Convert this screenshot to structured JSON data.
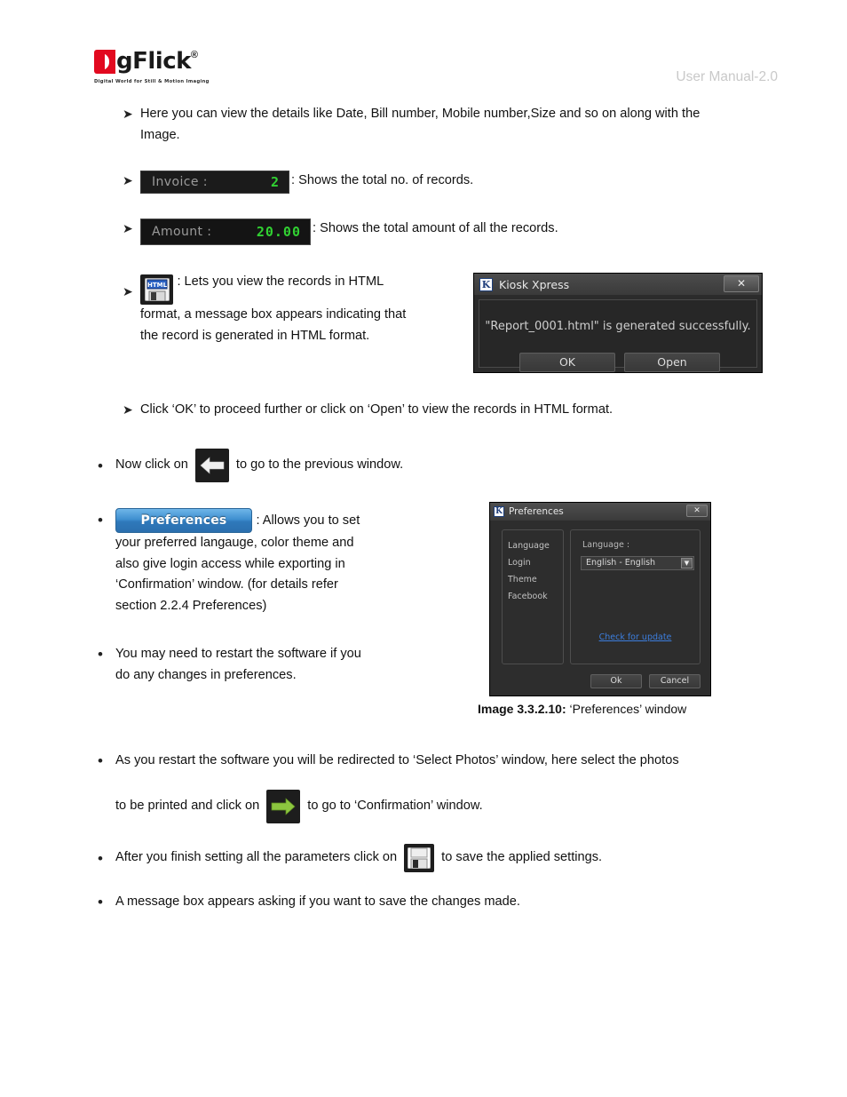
{
  "header": {
    "logo_d": "D",
    "logo_rest": "gFlick",
    "logo_registered": "®",
    "logo_tagline": "Digital World for Still & Motion Imaging",
    "manual_label": "User Manual-2.0"
  },
  "body": {
    "item1": "Here you can view the details like Date, Bill number, Mobile number,Size and so on along with the Image.",
    "invoice": {
      "label": "Invoice :",
      "value": "2",
      "description": ": Shows the total no. of records."
    },
    "amount": {
      "label": "Amount :",
      "value": "20.00",
      "description": ": Shows the total amount of all the records."
    },
    "html_item": {
      "icon_label": "HTML",
      "text": ": Lets you view the records in HTML format, a message box appears indicating that the record is generated in HTML format."
    },
    "item_ok_open": "Click ‘OK’ to proceed further or click on ‘Open’ to view the records in HTML format.",
    "back_item": {
      "prefix": "Now click on",
      "suffix": "to go to the previous window."
    },
    "preferences_item": {
      "button_label": "Preferences",
      "text_after_button": ": Allows you to set",
      "line2": "your preferred langauge, color theme and",
      "line3": "also give login access while exporting in",
      "line4": "‘Confirmation’ window. (for details refer",
      "line5": "section 2.2.4 Preferences)"
    },
    "restart_item": {
      "line1": "You may need to restart the software if you",
      "line2": "do any changes in preferences."
    },
    "select_photos_item": {
      "line1": "As you restart the software you will be redirected to ‘Select Photos’ window, here select the photos",
      "line2_prefix": "to be printed and click on",
      "line2_suffix": "to go to ‘Confirmation’ window."
    },
    "save_item": {
      "prefix": "After you finish setting all the parameters click on",
      "suffix": "to save the applied settings."
    },
    "message_box_item": "A message box appears asking if you want to save the changes made.",
    "caption": {
      "label": "Image 3.3.2.10:",
      "text": " ‘Preferences’ window"
    }
  },
  "kiosk_dialog": {
    "app_icon": "K",
    "title": "Kiosk Xpress",
    "close_label": "✕",
    "message": "\"Report_0001.html\" is generated successfully.",
    "ok_label": "OK",
    "open_label": "Open"
  },
  "preferences_dialog": {
    "app_icon": "K",
    "title": "Preferences",
    "close_label": "✕",
    "nav_items": [
      "Language",
      "Login",
      "Theme",
      "Facebook"
    ],
    "field_label": "Language :",
    "selected_language": "English - English",
    "dropdown_arrow": "▼",
    "update_link": "Check for update",
    "ok_label": "Ok",
    "cancel_label": "Cancel"
  },
  "colors": {
    "brand_red": "#e2091f",
    "lcd_green": "#31d132",
    "accent_blue": "#3f8fd0",
    "link_blue": "#3c7ede",
    "arrow_green": "#8cc63f"
  }
}
